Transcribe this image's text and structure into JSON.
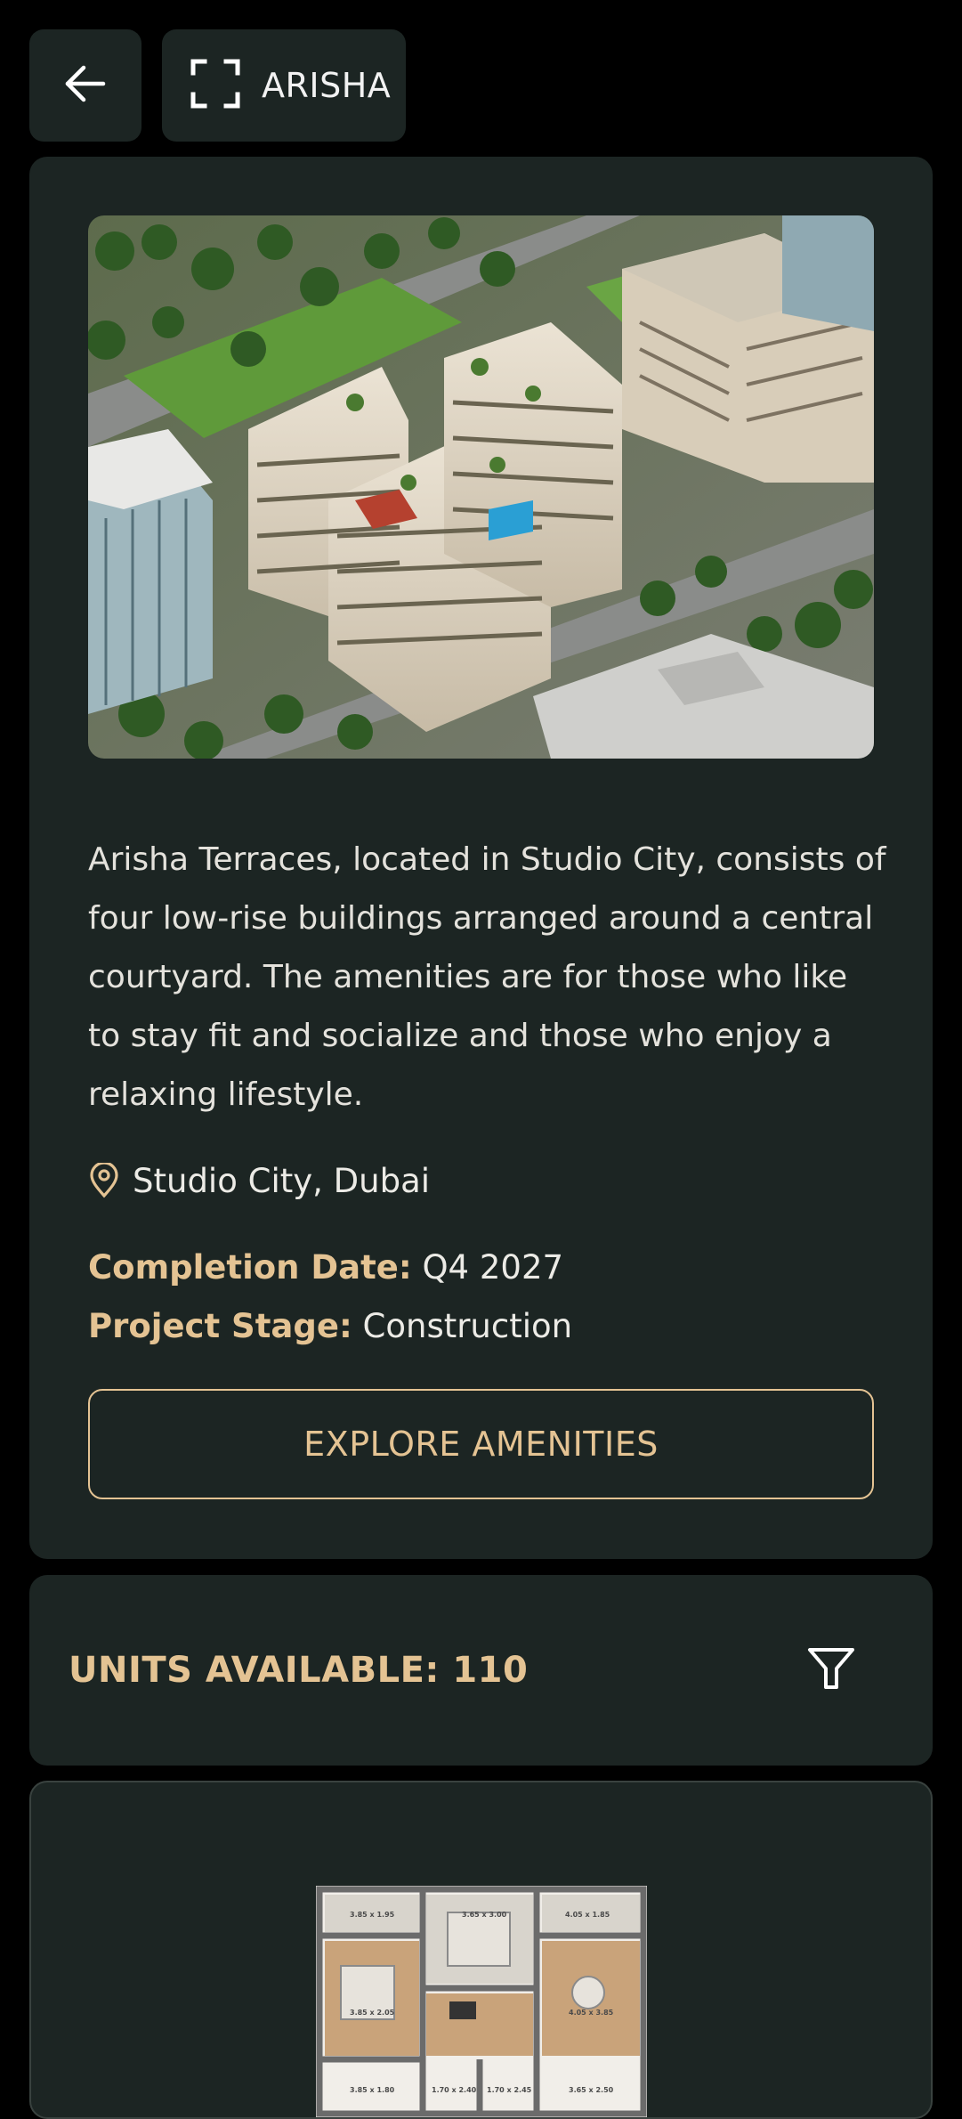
{
  "header": {
    "back_icon": "arrow-left-icon",
    "fullscreen_icon": "fullscreen-icon",
    "project_name": "ARISHA"
  },
  "project": {
    "image_alt": "Aerial rendering of Arisha Terraces",
    "description": "Arisha Terraces, located in Studio City, consists of four low-rise buildings arranged around a central courtyard. The amenities are for those who like to stay fit and socialize and those who enjoy a relaxing lifestyle.",
    "location_icon": "location-pin-icon",
    "location": "Studio City, Dubai",
    "completion_label": "Completion Date:",
    "completion_value": "Q4 2027",
    "stage_label": "Project Stage:",
    "stage_value": "Construction",
    "explore_button": "EXPLORE AMENITIES"
  },
  "units": {
    "title": "UNITS AVAILABLE: 110",
    "filter_icon": "filter-icon"
  },
  "unit_card": {
    "floorplan_labels": [
      "3.85 x 1.95",
      "3.65 x 3.00",
      "4.05 x 1.85",
      "3.85 x 2.05",
      "4.05 x 3.85",
      "3.85 x 1.80",
      "1.70 x 2.40",
      "1.70 x 2.45",
      "3.65 x 2.50"
    ]
  },
  "colors": {
    "background": "#000000",
    "card": "#1c2523",
    "accent": "#e4c393",
    "text": "#e9e6df"
  }
}
